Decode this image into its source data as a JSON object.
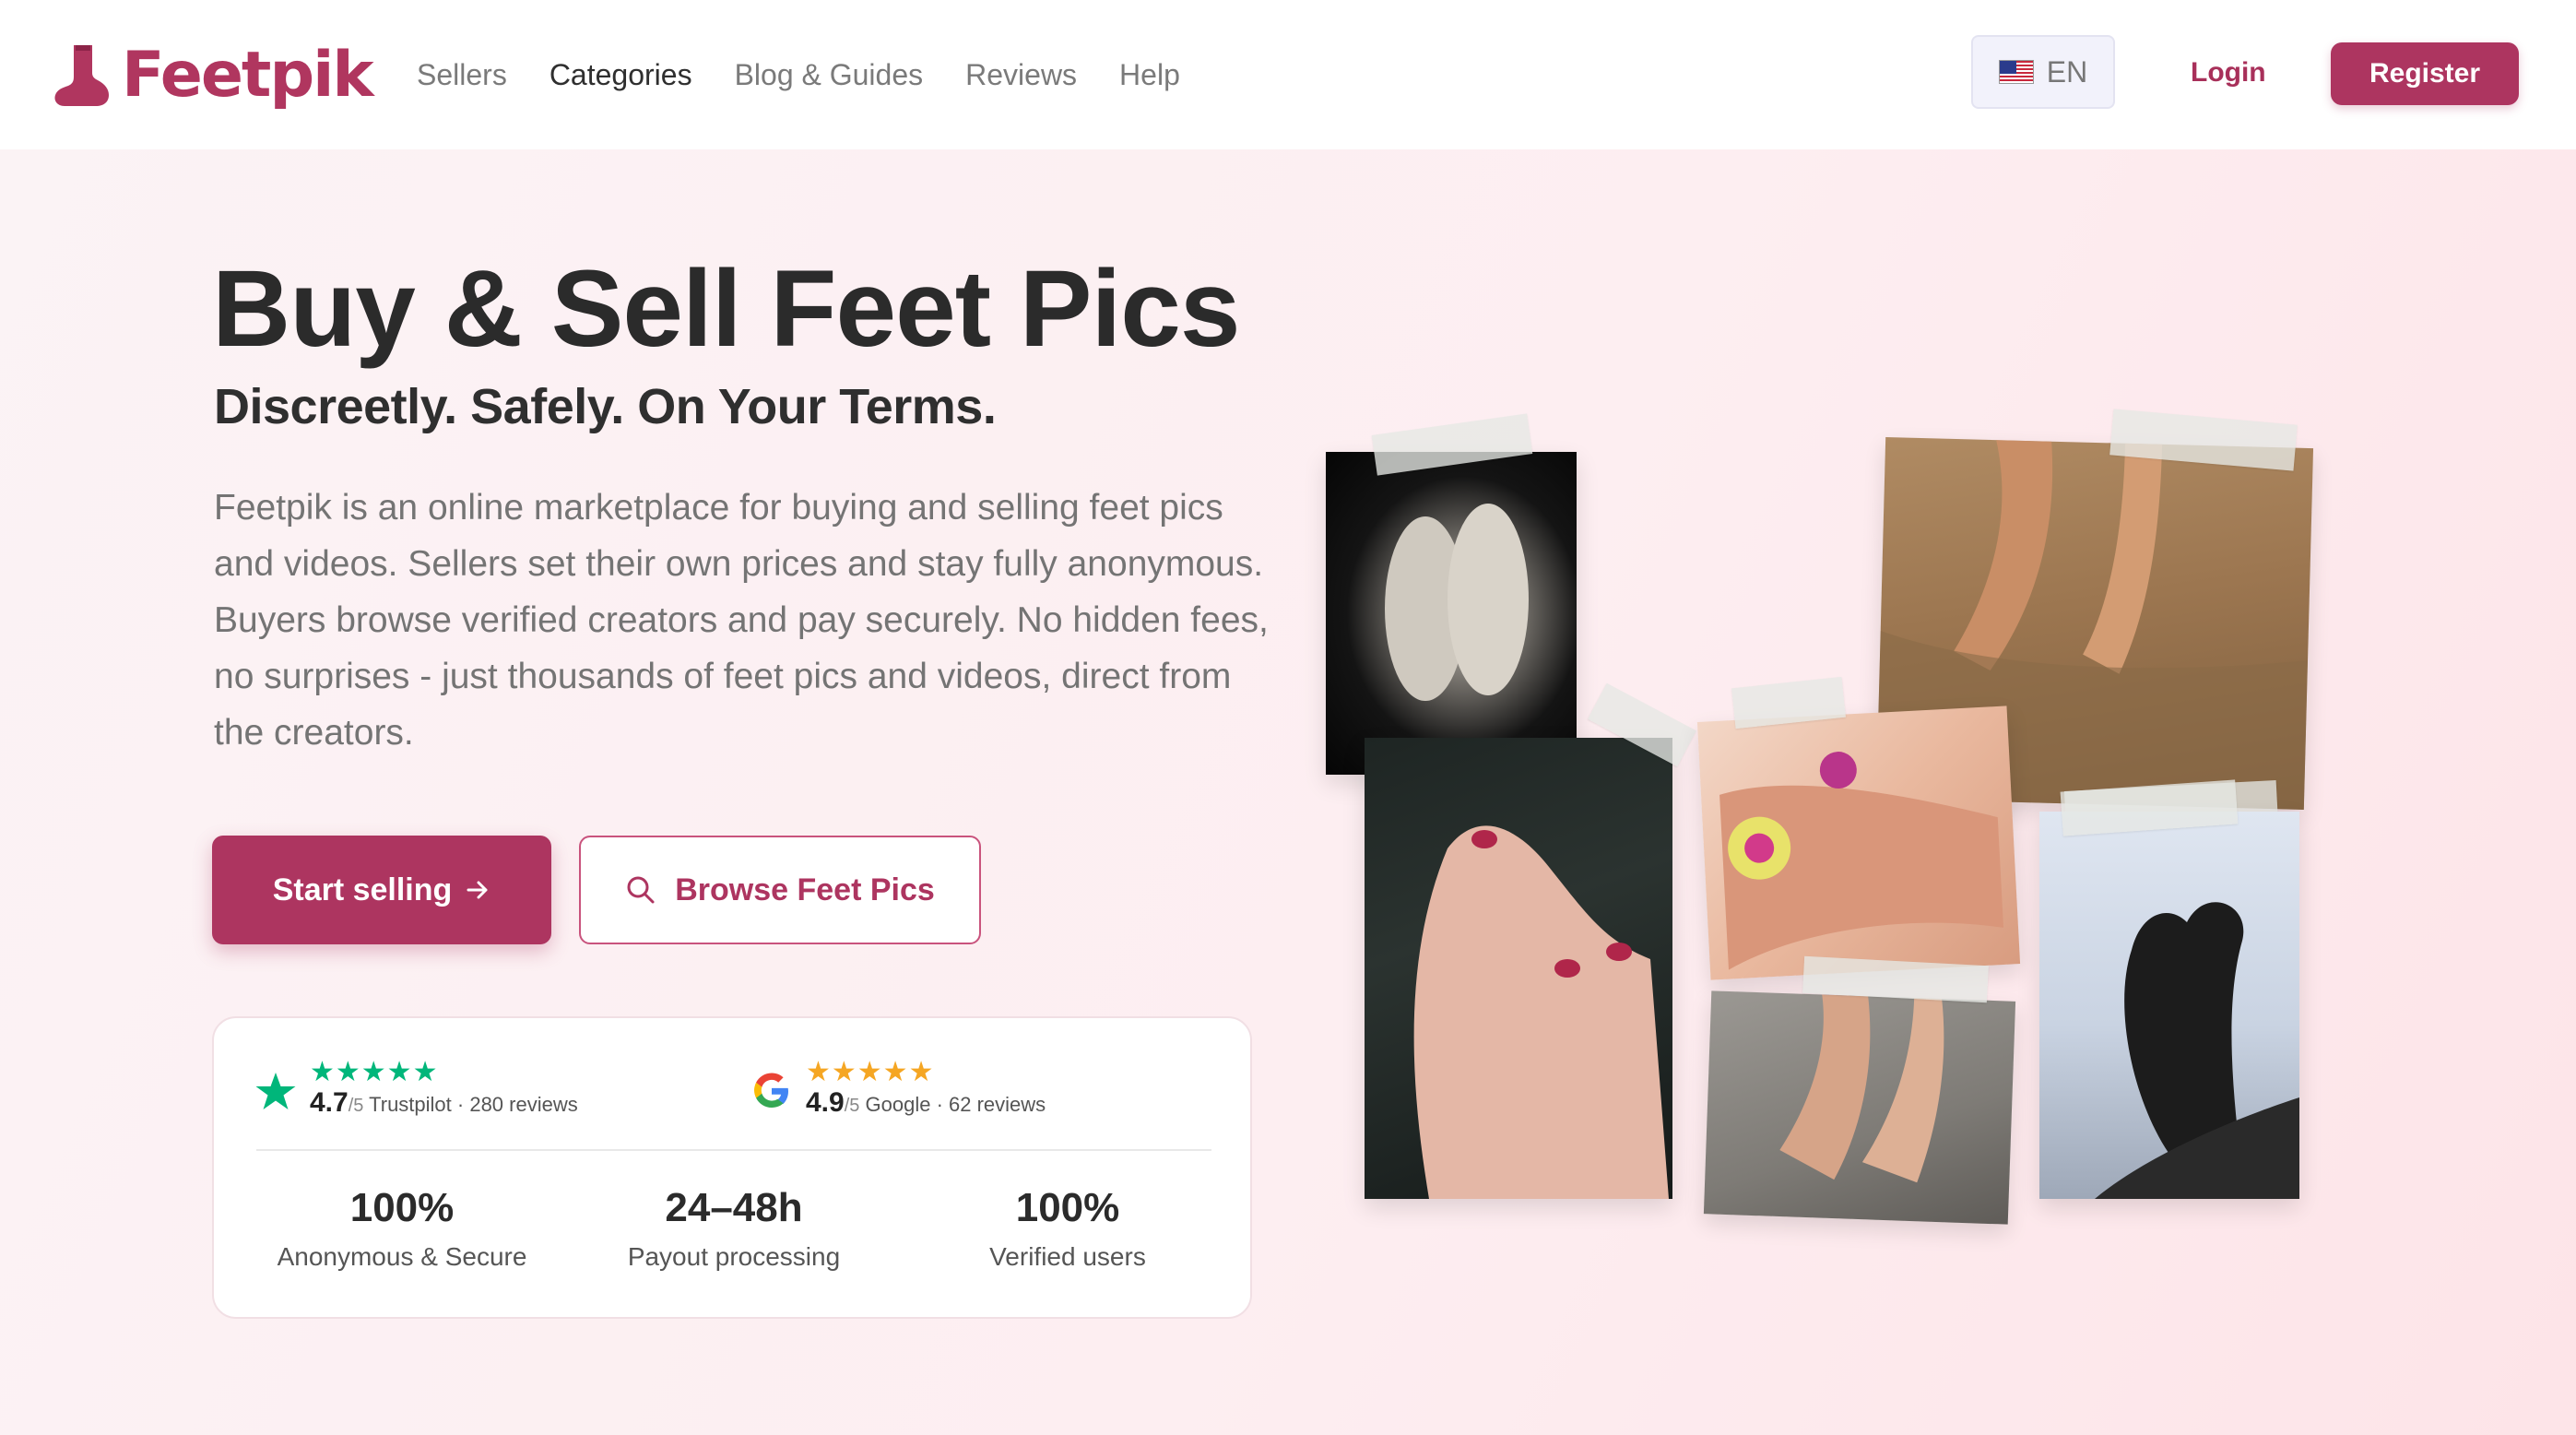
{
  "header": {
    "logo": "Feetpik",
    "nav": [
      "Sellers",
      "Categories",
      "Blog & Guides",
      "Reviews",
      "Help"
    ],
    "language": "EN",
    "login": "Login",
    "register": "Register"
  },
  "hero": {
    "title": "Buy & Sell Feet Pics",
    "subtitle": "Discreetly. Safely. On Your Terms.",
    "description": "Feetpik is an online marketplace for buying and selling feet pics and videos. Sellers set their own prices and stay fully anonymous. Buyers browse verified creators and pay securely. No hidden fees, no surprises - just thousands of feet pics and videos, direct from the creators.",
    "primary_button": "Start selling",
    "secondary_button": "Browse Feet Pics"
  },
  "ratings": [
    {
      "source": "Trustpilot",
      "score": "4.7",
      "out_of": "/5",
      "detail": "Trustpilot · 280 reviews",
      "stars": 5,
      "color": "#00b67a"
    },
    {
      "source": "Google",
      "score": "4.9",
      "out_of": "/5",
      "detail": "Google · 62 reviews",
      "stars": 5,
      "color": "#f5a623"
    }
  ],
  "stats": [
    {
      "value": "100%",
      "label": "Anonymous & Secure"
    },
    {
      "value": "24–48h",
      "label": "Payout processing"
    },
    {
      "value": "100%",
      "label": "Verified users"
    }
  ],
  "colors": {
    "brand": "#ad3560",
    "logo": "#b0365f"
  }
}
